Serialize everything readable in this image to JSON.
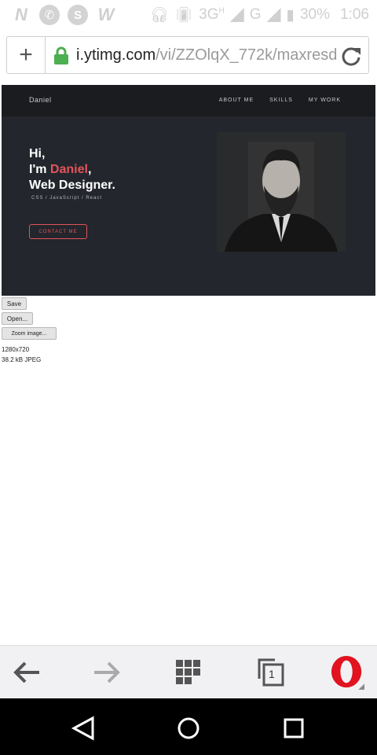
{
  "statusbar": {
    "left_icons": [
      {
        "name": "n-app-icon",
        "glyph": "N"
      },
      {
        "name": "whatsapp-icon",
        "glyph": "✆"
      },
      {
        "name": "skype-icon",
        "glyph": "S"
      },
      {
        "name": "w-app-icon",
        "glyph": "W"
      }
    ],
    "network": "3G",
    "network_sup": "H",
    "network2": "G",
    "battery": "30%",
    "time": "1:06"
  },
  "urlbar": {
    "host": "i.ytimg.com",
    "path": "/vi/ZZOlqX_772k/maxresd"
  },
  "hero": {
    "brand": "Daniel",
    "nav": [
      "ABOUT ME",
      "SKILLS",
      "MY WORK"
    ],
    "line1": "Hi,",
    "line2_prefix": "I'm ",
    "line2_name": "Daniel",
    "line2_suffix": ",",
    "line3": "Web Designer.",
    "subtitle": "CSS / JavaScript / React",
    "cta": "CONTACT ME"
  },
  "image_actions": {
    "save": "Save",
    "open": "Open...",
    "zoom": "Zoom image..."
  },
  "image_meta": {
    "dimensions": "1280x720",
    "size_type": "38.2 kB  JPEG"
  },
  "bottombar": {
    "tab_count": "1"
  },
  "colors": {
    "accent": "#e2545c",
    "hero_bg": "#23262c",
    "opera_red": "#e0131f",
    "lock_green": "#4caf50"
  }
}
